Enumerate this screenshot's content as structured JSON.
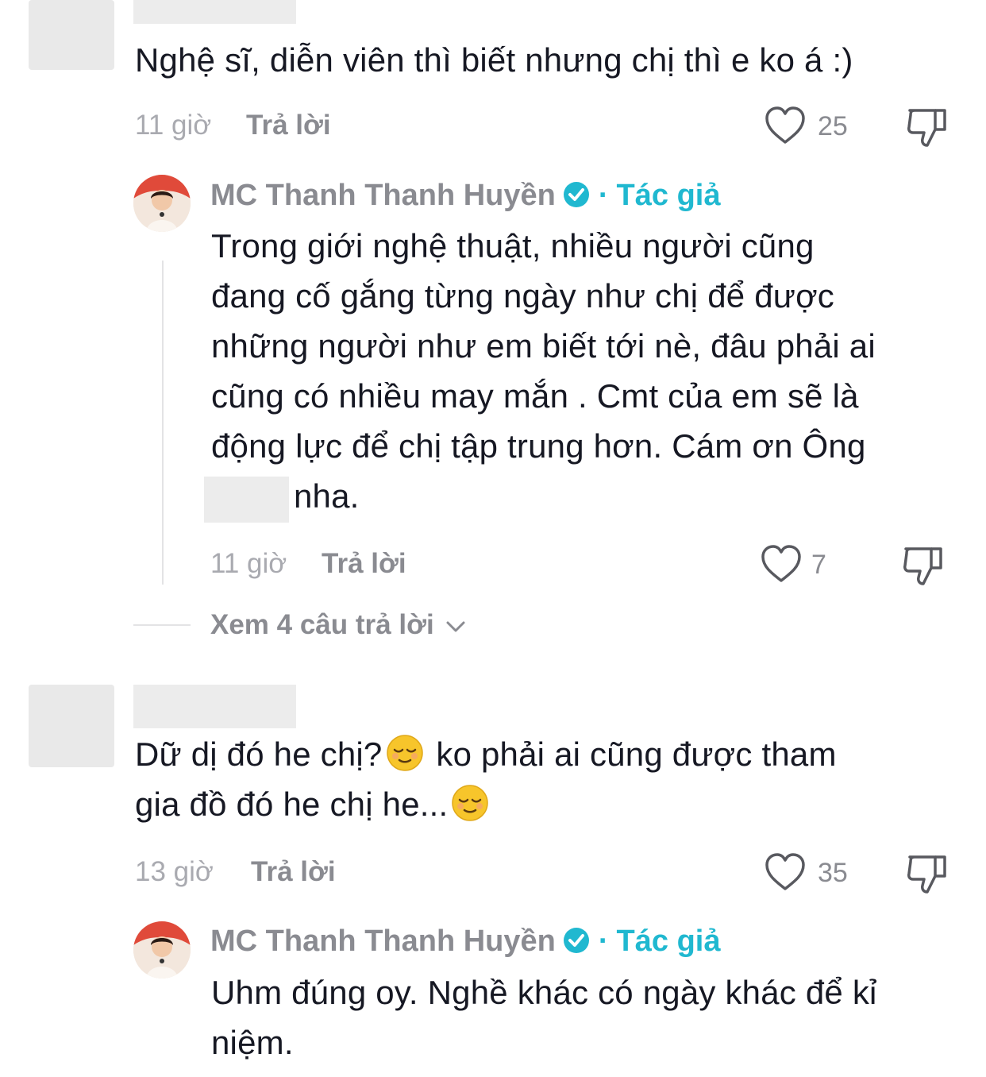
{
  "comments": [
    {
      "text": "Nghệ sĩ, diễn viên thì biết nhưng chị thì e ko á :)",
      "time": "11 giờ",
      "reply_label": "Trả lời",
      "likes": "25",
      "reply": {
        "author": "MC Thanh Thanh Huyền",
        "author_tag": "Tác giả",
        "lines": [
          "Trong giới nghệ thuật, nhiều người cũng",
          "đang cố gắng từng ngày như chị để được",
          "những người như em biết tới nè, đâu phải ai",
          "cũng có nhiều may mắn . Cmt của em sẽ là",
          "động lực để chị tập trung hơn. Cám ơn Ông",
          "nha."
        ],
        "time": "11 giờ",
        "reply_label": "Trả lời",
        "likes": "7"
      },
      "view_more": "Xem 4 câu trả lời"
    },
    {
      "text_part1": "Dữ dị đó he chị?",
      "text_part2": " ko phải ai cũng được tham",
      "text_line2": "gia đồ đó he chị he...",
      "time": "13 giờ",
      "reply_label": "Trả lời",
      "likes": "35",
      "reply": {
        "author": "MC Thanh Thanh Huyền",
        "author_tag": "Tác giả",
        "lines": [
          "Uhm đúng oy. Nghề khác có ngày khác để kỉ",
          "niệm."
        ]
      }
    }
  ],
  "icons": {
    "like": "heart-outline-icon",
    "dislike": "thumbs-down-icon",
    "verified": "verified-badge-icon",
    "expand": "chevron-down-icon",
    "emoji": "relieved-face-emoji"
  },
  "colors": {
    "text": "#161823",
    "secondary": "#8a8b91",
    "accent": "#20b8d0"
  }
}
